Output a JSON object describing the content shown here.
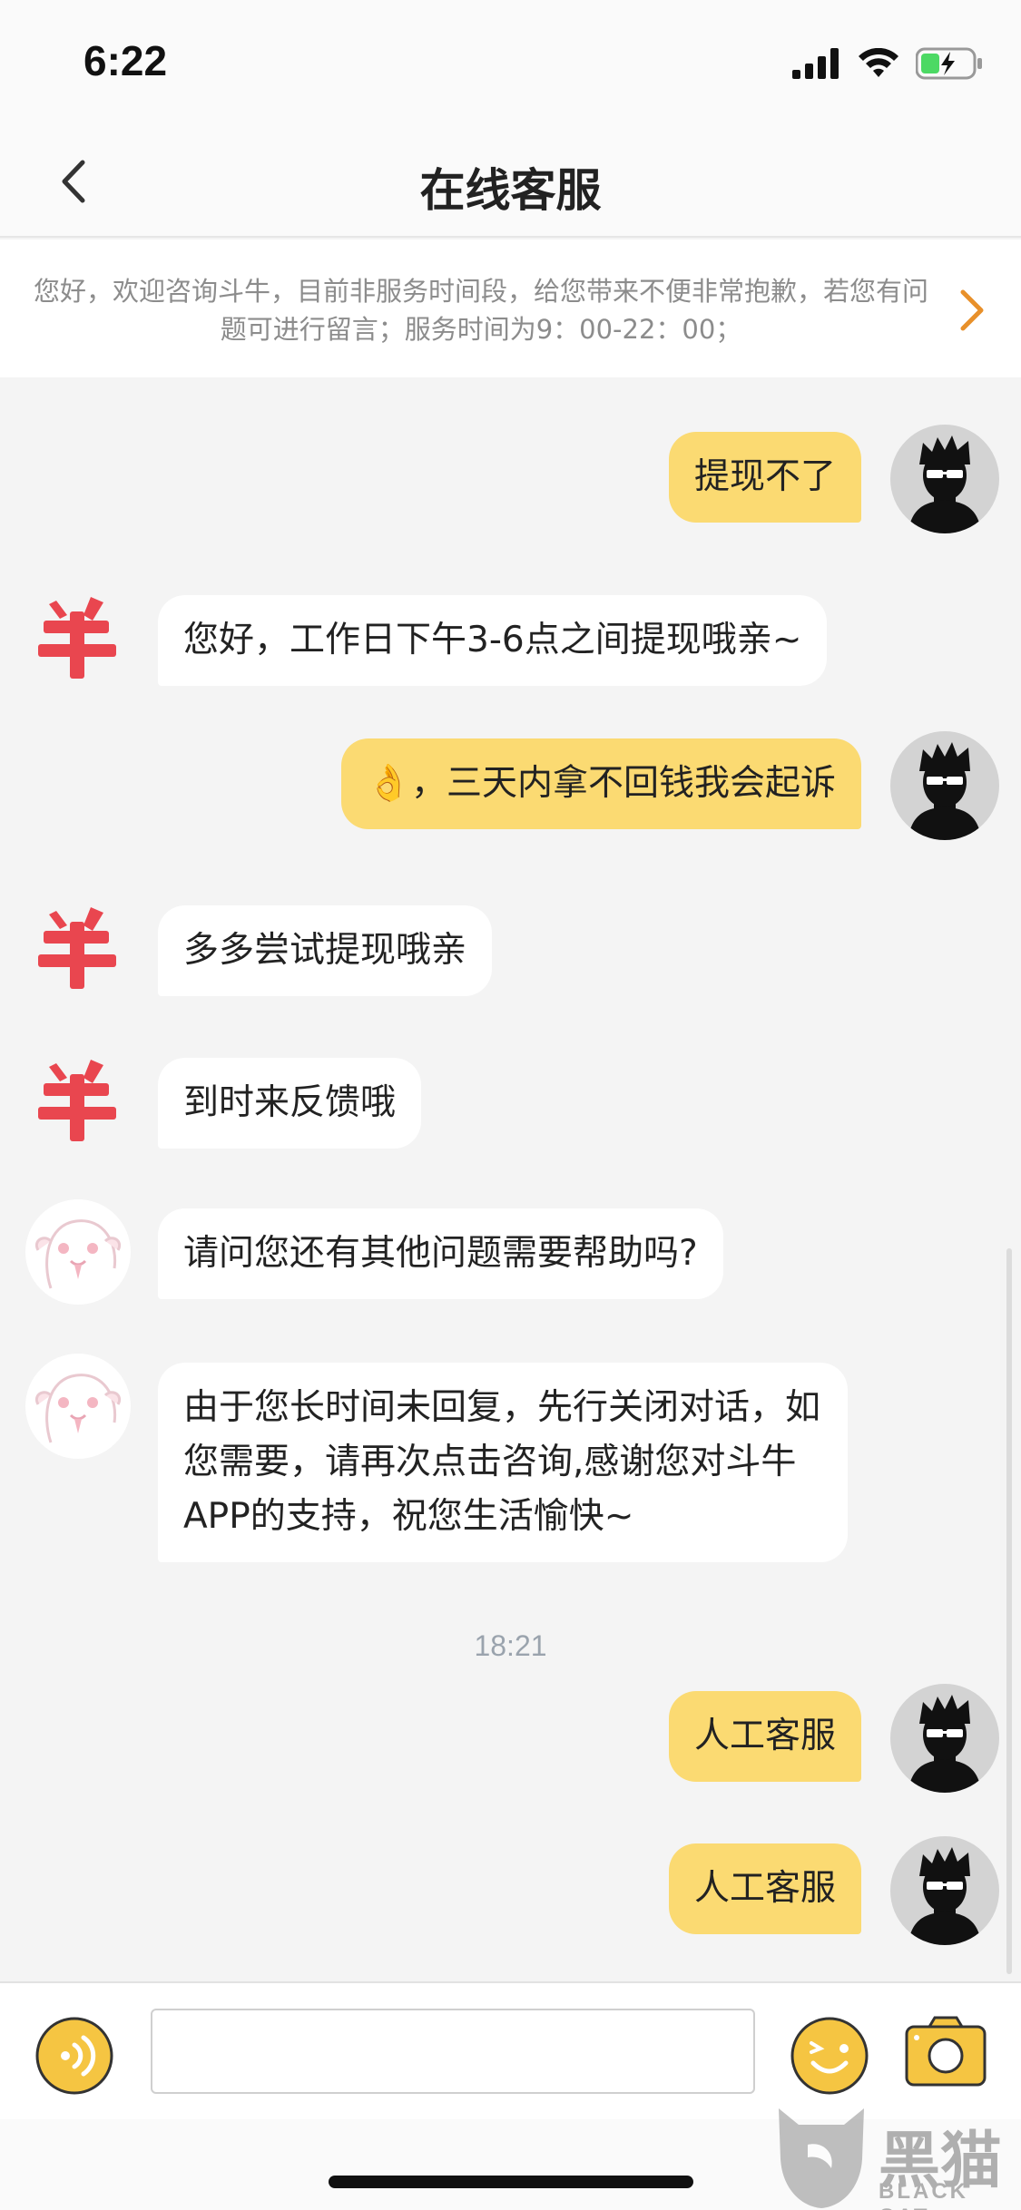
{
  "status_bar": {
    "time": "6:22"
  },
  "nav": {
    "title": "在线客服"
  },
  "notice": {
    "text": "您好，欢迎咨询斗牛，目前非服务时间段，给您带来不便非常抱歉，若您有问题可进行留言；服务时间为9：00-22：00；"
  },
  "messages": [
    {
      "side": "user",
      "text": "提现不了"
    },
    {
      "side": "bot",
      "avatar": "niu-logo",
      "text": "您好，工作日下午3-6点之间提现哦亲~"
    },
    {
      "side": "user",
      "emoji": "👌",
      "text": "，三天内拿不回钱我会起诉"
    },
    {
      "side": "bot",
      "avatar": "niu-logo",
      "text": "多多尝试提现哦亲"
    },
    {
      "side": "bot",
      "avatar": "niu-logo",
      "text": "到时来反馈哦"
    },
    {
      "side": "bot",
      "avatar": "cartoon",
      "text": "请问您还有其他问题需要帮助吗?"
    },
    {
      "side": "bot",
      "avatar": "cartoon",
      "text": "由于您长时间未回复，先行关闭对话，如您需要，请再次点击咨询,感谢您对斗牛APP的支持，祝您生活愉快~"
    },
    {
      "side": "user",
      "text": "人工客服"
    },
    {
      "side": "user",
      "text": "人工客服"
    }
  ],
  "timestamp": "18:21",
  "input": {
    "value": ""
  },
  "watermark": {
    "cn": "黑猫",
    "en": "BLACK CAT"
  },
  "colors": {
    "user_bubble": "#fbda72",
    "accent": "#f5c542",
    "arrow": "#e8902a"
  }
}
